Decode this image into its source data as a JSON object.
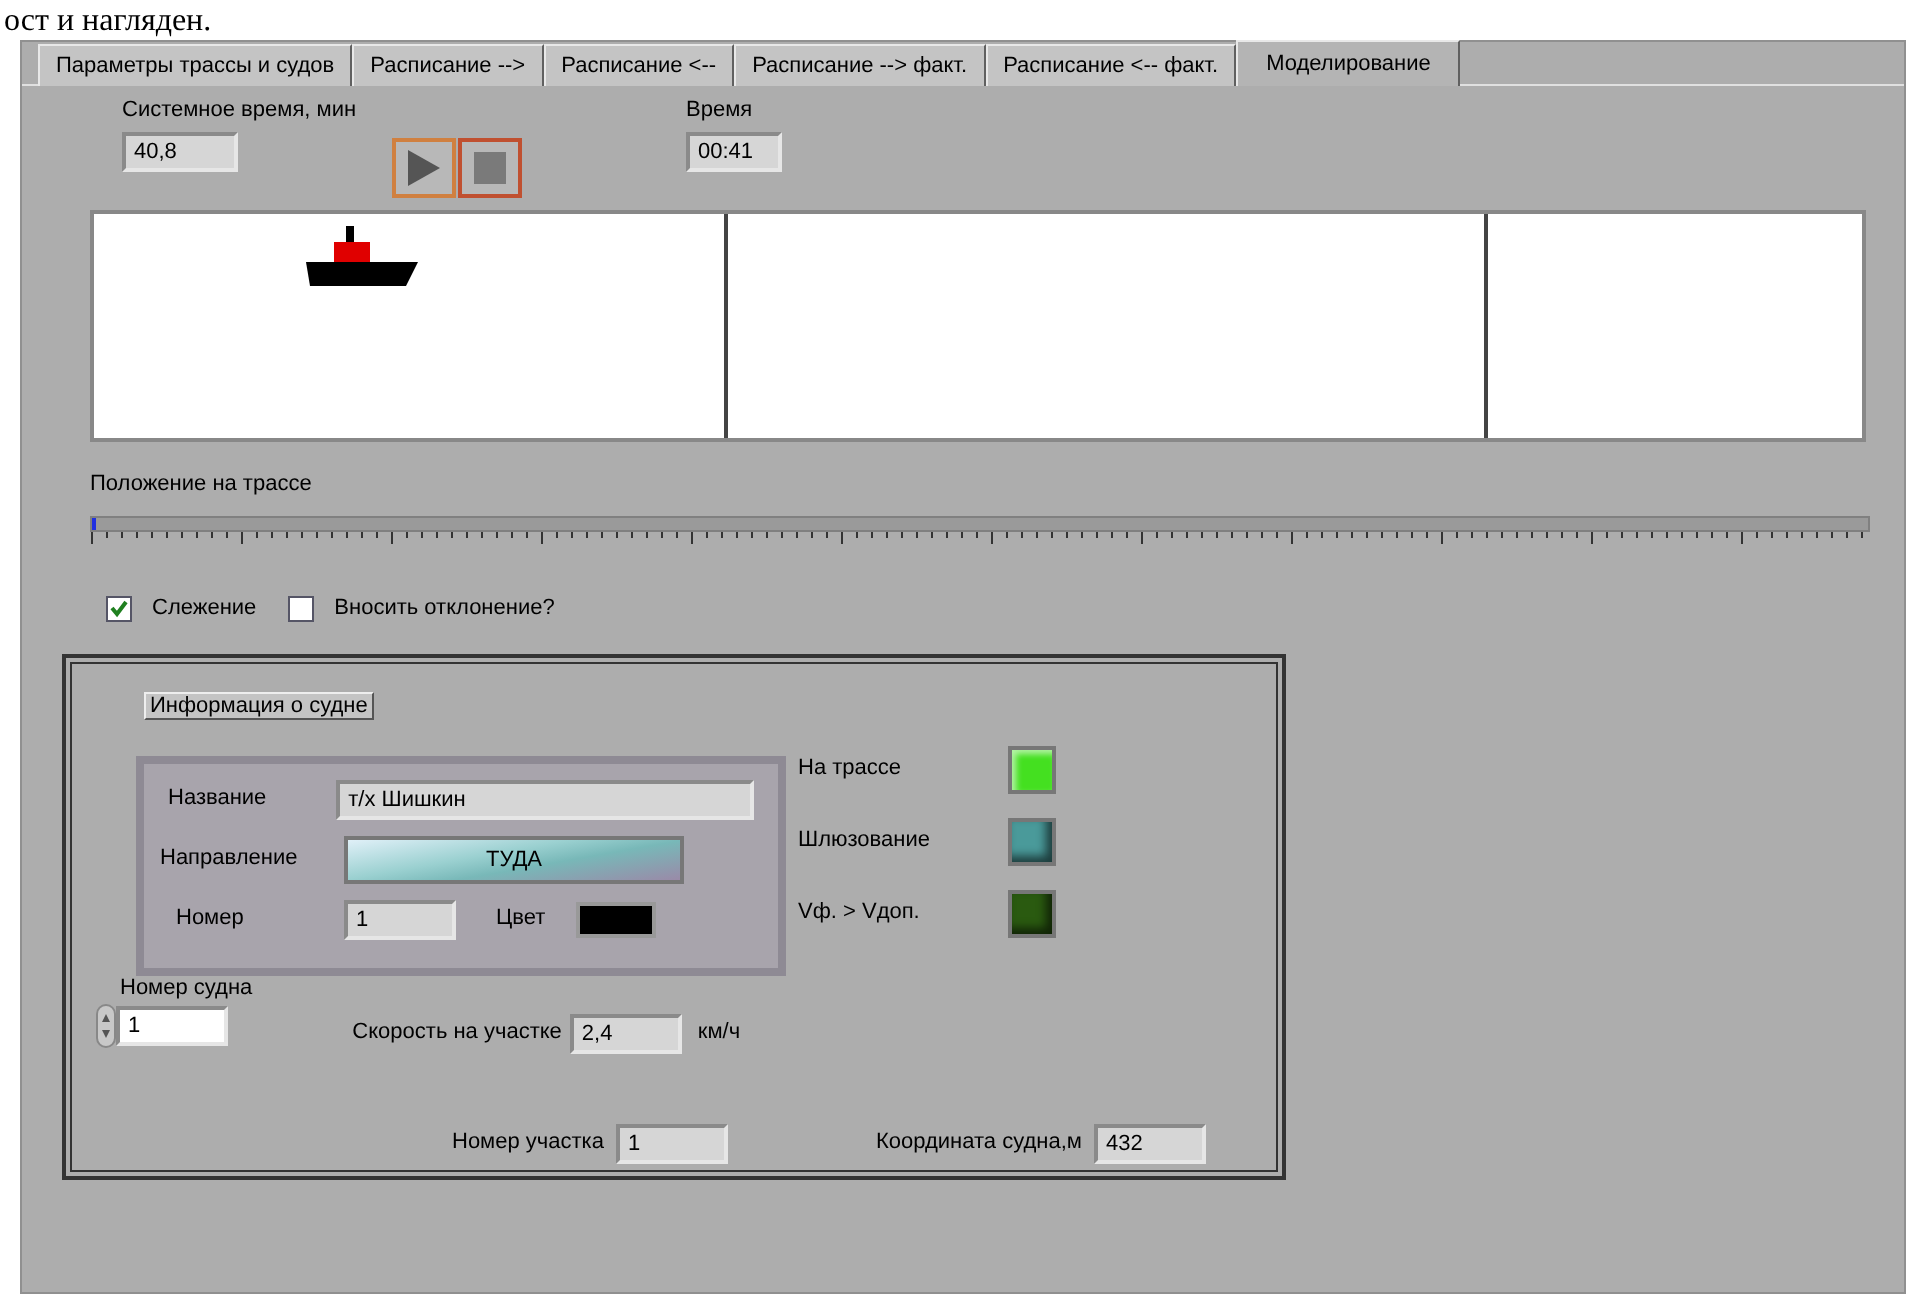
{
  "caption": "ост и нагляден.",
  "tabs": [
    {
      "label": "Параметры трассы и судов",
      "selected": false
    },
    {
      "label": "Расписание -->",
      "selected": false
    },
    {
      "label": "Расписание <--",
      "selected": false
    },
    {
      "label": "Расписание --> факт.",
      "selected": false
    },
    {
      "label": "Расписание <-- факт.",
      "selected": false
    },
    {
      "label": "Моделирование",
      "selected": true
    }
  ],
  "system_time": {
    "label": "Системное время, мин",
    "value": "40,8"
  },
  "time": {
    "label": "Время",
    "value": "00:41"
  },
  "position": {
    "label": "Положение на трассе",
    "level": 0.0
  },
  "checkboxes": [
    {
      "label": "Слежение",
      "checked": true
    },
    {
      "label": "Вносить отклонение?",
      "checked": false
    }
  ],
  "info": {
    "title": "Информация о судне",
    "name": {
      "label": "Название",
      "value": "т/х Шишкин"
    },
    "direction": {
      "label": "Направление",
      "value": "ТУДА"
    },
    "number": {
      "label": "Номер",
      "value": "1"
    },
    "color": {
      "label": "Цвет",
      "color": "#000000"
    },
    "indicators": [
      {
        "label": "На трассе",
        "on": true,
        "color": "#44e020"
      },
      {
        "label": "Шлюзование",
        "on": false,
        "color": "#4a9a9a"
      },
      {
        "label": "Vф. > Vдоп.",
        "on": false,
        "color": "#2a5a10"
      }
    ],
    "ship_number": {
      "label": "Номер судна",
      "value": "1"
    },
    "speed": {
      "label": "Скорость на участке",
      "value": "2,4",
      "unit": "км/ч"
    },
    "segment": {
      "label": "Номер участка",
      "value": "1"
    },
    "coordinate": {
      "label": "Координата судна,м",
      "value": "432"
    }
  }
}
